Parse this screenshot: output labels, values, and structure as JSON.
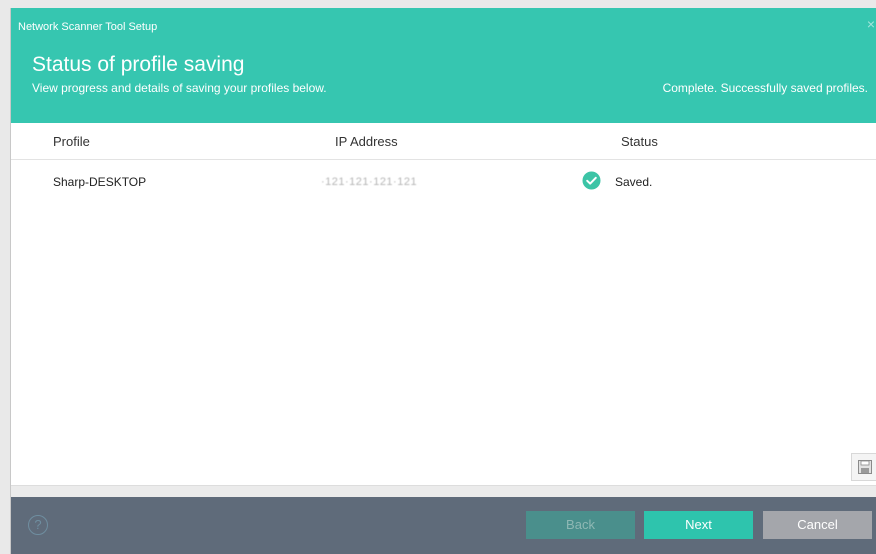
{
  "window": {
    "title": "Network Scanner Tool Setup",
    "close_symbol": "×"
  },
  "header": {
    "title": "Status of profile saving",
    "subtitle": "View progress and details of saving your profiles below.",
    "status_summary": "Complete. Successfully saved profiles."
  },
  "table": {
    "columns": [
      "Profile",
      "IP Address",
      "Status"
    ],
    "rows": [
      {
        "profile": "Sharp-DESKTOP",
        "ip_address": "·121·121·121·121",
        "status": "Saved.",
        "status_icon": "check-circle-icon"
      }
    ]
  },
  "footer": {
    "help_symbol": "?",
    "back_label": "Back",
    "next_label": "Next",
    "cancel_label": "Cancel"
  },
  "colors": {
    "header_bg": "#36c6b0",
    "footer_bg": "#5f6b7a",
    "next_button": "#2ec4ad",
    "back_button_disabled": "#4a8f8c",
    "cancel_button": "#a4a6ab",
    "success": "#3cc4a6"
  }
}
